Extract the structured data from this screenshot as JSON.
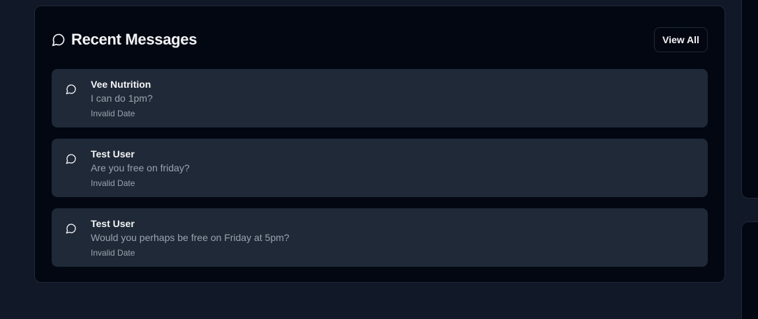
{
  "recent_messages": {
    "title": "Recent Messages",
    "view_all_label": "View All",
    "icon": "message-circle-icon",
    "items": [
      {
        "sender": "Vee Nutrition",
        "text": "I can do 1pm?",
        "time": "Invalid Date"
      },
      {
        "sender": "Test User",
        "text": "Are you free on friday?",
        "time": "Invalid Date"
      },
      {
        "sender": "Test User",
        "text": "Would you perhaps be free on Friday at 5pm?",
        "time": "Invalid Date"
      }
    ]
  },
  "colors": {
    "page_bg": "#111827",
    "card_bg": "#030712",
    "item_bg": "#1f2937",
    "text_primary": "#f3f4f6",
    "text_muted": "#9ca3af"
  }
}
